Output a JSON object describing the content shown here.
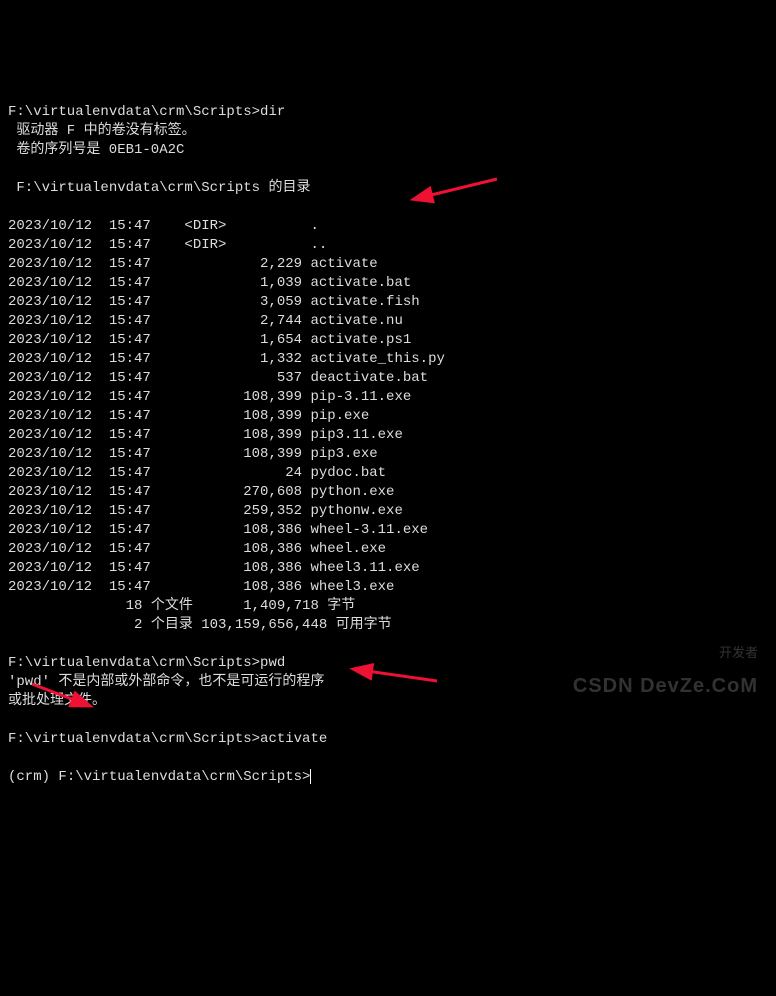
{
  "prompts": {
    "p1_path": "F:\\virtualenvdata\\crm\\Scripts>",
    "p1_cmd": "dir",
    "vol_label": " 驱动器 F 中的卷没有标签。",
    "vol_serial": " 卷的序列号是 0EB1-0A2C",
    "dir_of": " F:\\virtualenvdata\\crm\\Scripts 的目录",
    "p2_path": "F:\\virtualenvdata\\crm\\Scripts>",
    "p2_cmd": "pwd",
    "pwd_err1": "'pwd' 不是内部或外部命令，也不是可运行的程序",
    "pwd_err2": "或批处理文件。",
    "p3_path": "F:\\virtualenvdata\\crm\\Scripts>",
    "p3_cmd": "activate",
    "p4_prefix": "(crm) ",
    "p4_path": "F:\\virtualenvdata\\crm\\Scripts>"
  },
  "listing": [
    "2023/10/12  15:47    <DIR>          .",
    "2023/10/12  15:47    <DIR>          ..",
    "2023/10/12  15:47             2,229 activate",
    "2023/10/12  15:47             1,039 activate.bat",
    "2023/10/12  15:47             3,059 activate.fish",
    "2023/10/12  15:47             2,744 activate.nu",
    "2023/10/12  15:47             1,654 activate.ps1",
    "2023/10/12  15:47             1,332 activate_this.py",
    "2023/10/12  15:47               537 deactivate.bat",
    "2023/10/12  15:47           108,399 pip-3.11.exe",
    "2023/10/12  15:47           108,399 pip.exe",
    "2023/10/12  15:47           108,399 pip3.11.exe",
    "2023/10/12  15:47           108,399 pip3.exe",
    "2023/10/12  15:47                24 pydoc.bat",
    "2023/10/12  15:47           270,608 python.exe",
    "2023/10/12  15:47           259,352 pythonw.exe",
    "2023/10/12  15:47           108,386 wheel-3.11.exe",
    "2023/10/12  15:47           108,386 wheel.exe",
    "2023/10/12  15:47           108,386 wheel3.11.exe",
    "2023/10/12  15:47           108,386 wheel3.exe"
  ],
  "summary": {
    "files": "              18 个文件      1,409,718 字节",
    "dirs": "               2 个目录 103,159,656,448 可用字节"
  },
  "watermark": {
    "line1": "开发者",
    "line2": "CSDN DevZe.CoM"
  }
}
